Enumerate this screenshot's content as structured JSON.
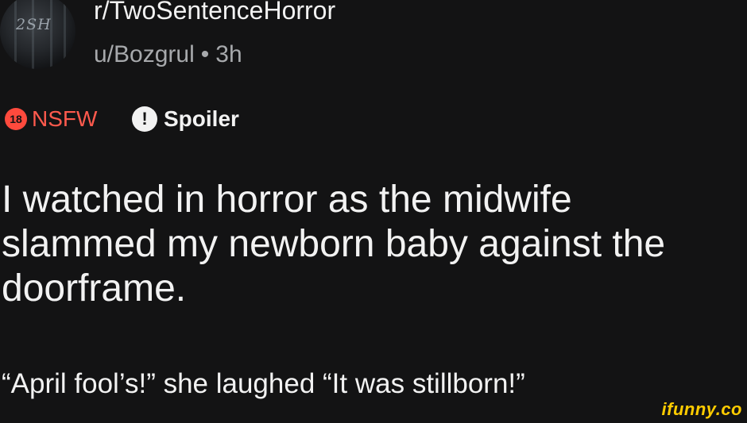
{
  "post": {
    "avatar_text": "2SH",
    "subreddit": "r/TwoSentenceHorror",
    "author": "u/Bozgrul",
    "separator": "•",
    "age": "3h",
    "tags": {
      "nsfw_badge": "18",
      "nsfw_label": "NSFW",
      "spoiler_badge": "!",
      "spoiler_label": "Spoiler"
    },
    "title_lines": [
      "I watched in horror as the midwife",
      "slammed my newborn baby against the",
      "doorframe."
    ],
    "body": "“April fool’s!” she laughed “It was stillborn!”"
  },
  "watermark": "ifunny.co",
  "colors": {
    "background": "#131314",
    "nsfw": "#ff5a4d",
    "watermark": "#ffcc00"
  }
}
